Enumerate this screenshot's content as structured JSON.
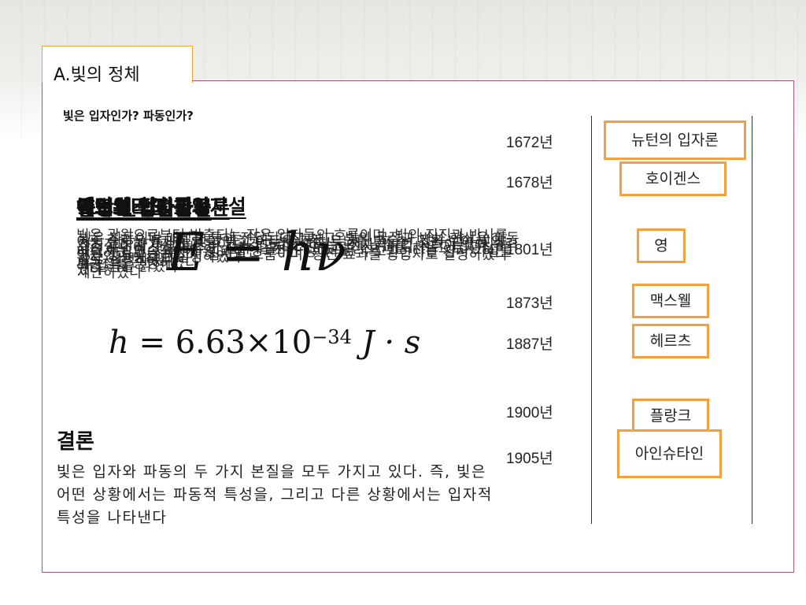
{
  "title": "A.빛의 정체",
  "question": "빛은 입자인가? 파동인가?",
  "overlay": {
    "headings": [
      "뉴턴의 입자론",
      "호이겐스의 파동론",
      "영의 간섭실험",
      "맥스웰 전자기파",
      "헤르츠 광전효과",
      "플랑크 양자가설",
      "아인슈타인 광양자설"
    ],
    "paragraphs": [
      "빛은 광원으로부터 방출되는 작은 입자들의 흐름이며, 빛의 직진과 반사를 입자의 운동으로 설명하였다",
      "빛은 파동이며 매질을 통해 전달된다고 보고, 빛의 굴절과 반사 현상을 파동으로 설명하였다",
      "이중 슬릿을 통과한 빛이 밝고 어두운 간섭 무늬를 만드는 것을 보여 빛의 파동성을 증명하였다",
      "전기장과 자기장의 진동이 공간으로 전파되는 전자기파의 속력이 빛의 속력과 같음을 밝혔다",
      "금속 표면에 빛을 비추면 전자가 튀어나오는 광전 효과를 처음으로 관찰하였다",
      "에너지는 연속적이지 않고 불연속적인 덩어리로 주고받는다는 양자 가설을 제안하였다",
      "빛은 광자라는 에너지 입자의 흐름이며, 광전 효과를 광양자로 설명하였다"
    ]
  },
  "formula_1": "E = hν",
  "formula_2": {
    "lhs": "h",
    "eq": "= 6.63×10",
    "exp": "−34",
    "unit": "J · s"
  },
  "conclusion": {
    "title": "결론",
    "text": "빛은 입자와 파동의 두 가지 본질을 모두 가지고 있다. 즉, 빛은 어떤 상황에서는 파동적 특성을, 그리고 다른 상황에서는 입자적 특성을 나타낸다"
  },
  "timeline": [
    {
      "year": "1672년",
      "name": "뉴턴의 입자론"
    },
    {
      "year": "1678년",
      "name": "호이겐스"
    },
    {
      "year": "1801년",
      "name": "영"
    },
    {
      "year": "1873년",
      "name": "맥스웰"
    },
    {
      "year": "1887년",
      "name": "헤르츠"
    },
    {
      "year": "1900년",
      "name": "플랑크"
    },
    {
      "year": "1905년",
      "name": "아인슈타인"
    }
  ],
  "colors": {
    "accent_orange": "#f4a040",
    "frame_border": "#a8567a"
  }
}
